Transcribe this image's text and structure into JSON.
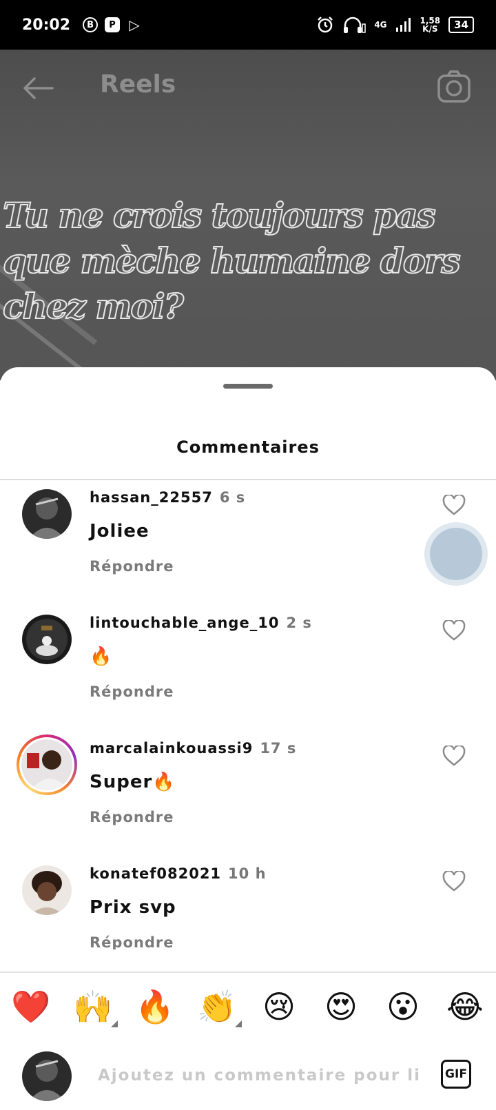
{
  "status_bar": {
    "time": "20:02",
    "apps": [
      "B",
      "P",
      "▷"
    ],
    "network": "4G",
    "speed_top": "1,58",
    "speed_bottom": "K/S",
    "battery": "34"
  },
  "reel": {
    "title": "Reels",
    "caption": "Tu ne crois toujours pas que mèche humaine dors chez moi?"
  },
  "sheet": {
    "title": "Commentaires"
  },
  "comments": [
    {
      "username": "hassan_22557",
      "time": "6 s",
      "text": "Joliee",
      "reply": "Répondre"
    },
    {
      "username": "lintouchable_ange_10",
      "time": "2 s",
      "text": "🔥",
      "reply": "Répondre"
    },
    {
      "username": "marcalainkouassi9",
      "time": "17 s",
      "text": "Super🔥",
      "reply": "Répondre"
    },
    {
      "username": "konatef082021",
      "time": "10 h",
      "text": "Prix svp",
      "reply": "Répondre"
    }
  ],
  "emoji_bar": [
    "❤️",
    "🙌",
    "🔥",
    "👏",
    "😢",
    "😍",
    "😮",
    "😂"
  ],
  "input": {
    "placeholder": "Ajoutez un commentaire pour lili_w",
    "gif_label": "GIF"
  },
  "icons": {
    "back": "back-arrow-icon",
    "camera": "camera-icon",
    "heart": "heart-outline-icon"
  }
}
